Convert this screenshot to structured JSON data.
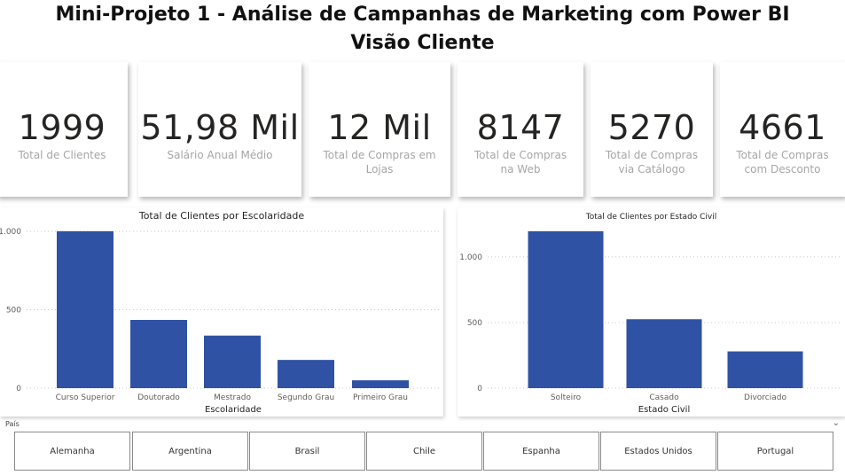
{
  "header": {
    "title": "Mini-Projeto 1 - Análise de Campanhas de Marketing com Power BI",
    "subtitle": "Visão Cliente"
  },
  "kpis": [
    {
      "value": "1999",
      "label": "Total de Clientes"
    },
    {
      "value": "51,98 Mil",
      "label": "Salário Anual Médio"
    },
    {
      "value": "12 Mil",
      "label": "Total de Compras em Lojas"
    },
    {
      "value": "8147",
      "label": "Total de Compras na Web"
    },
    {
      "value": "5270",
      "label": "Total de Compras via Catálogo"
    },
    {
      "value": "4661",
      "label": "Total de Compras com Desconto"
    }
  ],
  "chart_data": [
    {
      "type": "bar",
      "title": "Total de Clientes por Escolaridade",
      "xlabel": "Escolaridade",
      "ylabel": "",
      "categories": [
        "Curso Superior",
        "Doutorado",
        "Mestrado",
        "Segundo Grau",
        "Primeiro Grau"
      ],
      "values": [
        1000,
        435,
        335,
        180,
        50
      ],
      "ylim": [
        0,
        1000
      ],
      "yticks": [
        0,
        500,
        1000
      ],
      "ytick_labels": [
        "0",
        "500",
        "1.000"
      ],
      "grid": true,
      "color": "#2f52a4"
    },
    {
      "type": "bar",
      "title": "Total de Clientes por Estado Civil",
      "xlabel": "Estado Civil",
      "ylabel": "",
      "categories": [
        "Solteiro",
        "Casado",
        "Divorciado"
      ],
      "values": [
        1195,
        525,
        280
      ],
      "ylim": [
        0,
        1195
      ],
      "yticks": [
        0,
        500,
        1000
      ],
      "ytick_labels": [
        "0",
        "500",
        "1.000"
      ],
      "grid": true,
      "color": "#2f52a4"
    }
  ],
  "slicer": {
    "label": "País",
    "options": [
      "Alemanha",
      "Argentina",
      "Brasil",
      "Chile",
      "Espanha",
      "Estados Unidos",
      "Portugal"
    ]
  }
}
